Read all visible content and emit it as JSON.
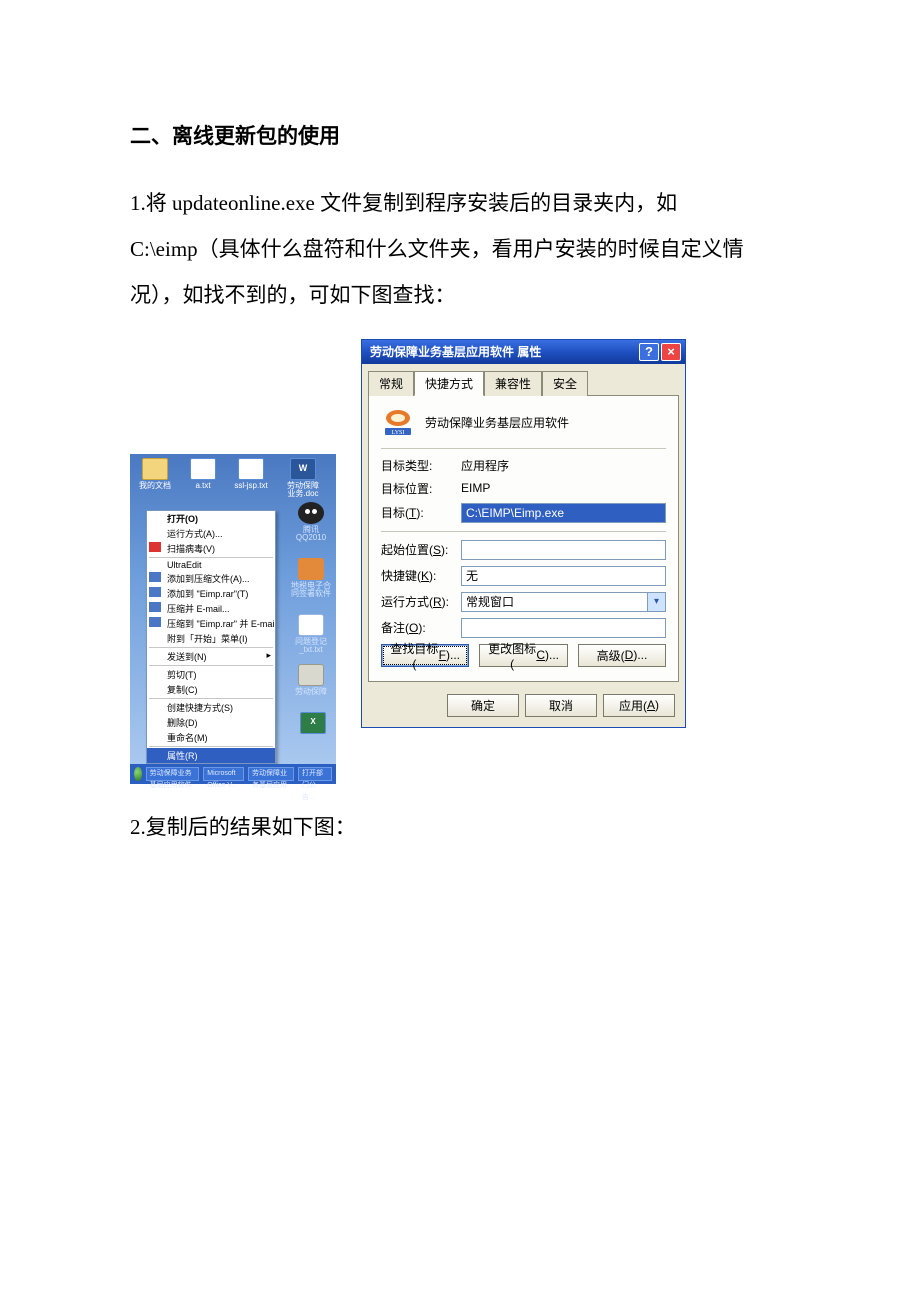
{
  "doc": {
    "heading": "二、离线更新包的使用",
    "p1a": "1.将 updateonline.exe 文件复制到程序安装后的目录夹内，如",
    "p1b": "C:\\eimp（具体什么盘符和什么文件夹，看用户安装的时候自定义情况），如找不到的，可如下图查找：",
    "p2": "2.复制后的结果如下图："
  },
  "desktop": {
    "icons": {
      "mydocs": "我的文档",
      "atxt": "a.txt",
      "ssljsp": "ssl-jsp.txt",
      "worddoc": "劳动保障业务.doc"
    },
    "side": {
      "qq": "腾讯QQ2010",
      "elec": "地税电子合同签署软件",
      "notes": "问题登记 _txt.txt",
      "ysf": "劳动保障"
    },
    "context_menu": [
      {
        "label": "打开(O)",
        "bold": true
      },
      {
        "label": "运行方式(A)..."
      },
      {
        "label": "扫描病毒(V)",
        "icon": "k"
      },
      {
        "sep": true
      },
      {
        "label": "UltraEdit"
      },
      {
        "label": "添加到压缩文件(A)...",
        "icon": "r"
      },
      {
        "label": "添加到 \"Eimp.rar\"(T)",
        "icon": "r"
      },
      {
        "label": "压缩并 E-mail...",
        "icon": "r"
      },
      {
        "label": "压缩到 \"Eimp.rar\" 并 E-mail",
        "icon": "r"
      },
      {
        "label": "附到「开始」菜单(I)"
      },
      {
        "sep": true
      },
      {
        "label": "发送到(N)",
        "sub": "▸"
      },
      {
        "sep": true
      },
      {
        "label": "剪切(T)"
      },
      {
        "label": "复制(C)"
      },
      {
        "sep": true
      },
      {
        "label": "创建快捷方式(S)"
      },
      {
        "label": "删除(D)"
      },
      {
        "label": "重命名(M)"
      },
      {
        "sep": true
      },
      {
        "label": "属性(R)",
        "sel": true
      }
    ],
    "taskbar": {
      "items": [
        "劳动保障业务基层应用软件",
        "Microsoft Office V...",
        "劳动保障业务基层应用",
        "打开部门公告..."
      ]
    }
  },
  "dialog": {
    "title": "劳动保障业务基层应用软件 属性",
    "tabs": {
      "general": "常规",
      "shortcut": "快捷方式",
      "compat": "兼容性",
      "security": "安全"
    },
    "name": "劳动保障业务基层应用软件",
    "rows": {
      "targetType": {
        "label": "目标类型:",
        "value": "应用程序"
      },
      "targetLoc": {
        "label": "目标位置:",
        "value": "EIMP"
      },
      "target": {
        "label": "目标(T):",
        "u": "T",
        "value": "C:\\EIMP\\Eimp.exe"
      },
      "startIn": {
        "label": "起始位置(S):",
        "u": "S",
        "value": ""
      },
      "shortcutKey": {
        "label": "快捷键(K):",
        "u": "K",
        "value": "无"
      },
      "run": {
        "label": "运行方式(R):",
        "u": "R",
        "value": "常规窗口"
      },
      "comment": {
        "label": "备注(O):",
        "u": "O",
        "value": ""
      }
    },
    "btns": {
      "findTarget": "查找目标(F)...",
      "findTarget_u": "F",
      "changeIcon": "更改图标(C)...",
      "changeIcon_u": "C",
      "advanced": "高级(D)...",
      "advanced_u": "D",
      "ok": "确定",
      "cancel": "取消",
      "apply": "应用(A)",
      "apply_u": "A"
    }
  }
}
